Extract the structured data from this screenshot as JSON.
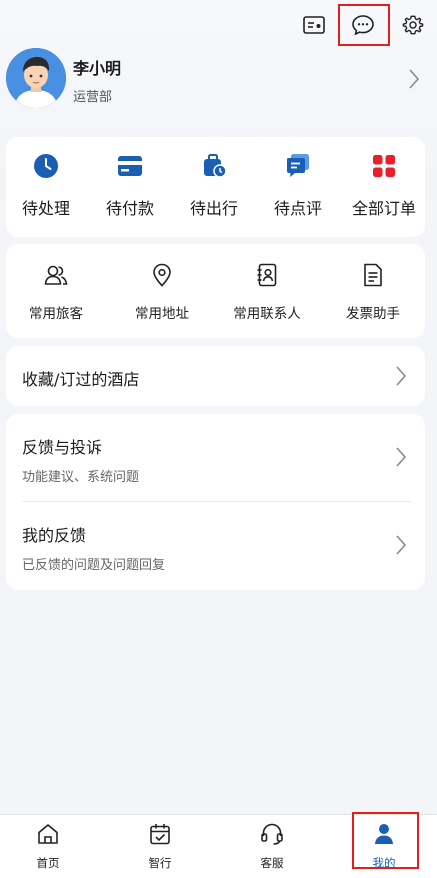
{
  "profile": {
    "name": "李小明",
    "department": "运营部"
  },
  "orders": [
    {
      "label": "待处理",
      "icon": "clock-icon"
    },
    {
      "label": "待付款",
      "icon": "card-icon"
    },
    {
      "label": "待出行",
      "icon": "luggage-icon"
    },
    {
      "label": "待点评",
      "icon": "comment-icon"
    },
    {
      "label": "全部订单",
      "icon": "grid-icon"
    }
  ],
  "services": [
    {
      "label": "常用旅客",
      "icon": "users-icon"
    },
    {
      "label": "常用地址",
      "icon": "location-pin-icon"
    },
    {
      "label": "常用联系人",
      "icon": "contacts-book-icon"
    },
    {
      "label": "发票助手",
      "icon": "invoice-icon"
    }
  ],
  "hotels": {
    "label": "收藏/订过的酒店"
  },
  "feedback": {
    "complaint": {
      "title": "反馈与投诉",
      "subtitle": "功能建议、系统问题"
    },
    "mine": {
      "title": "我的反馈",
      "subtitle": "已反馈的问题及问题回复"
    }
  },
  "tabs": [
    {
      "label": "首页",
      "icon": "home-icon"
    },
    {
      "label": "智行",
      "icon": "calendar-check-icon"
    },
    {
      "label": "客服",
      "icon": "headset-icon"
    },
    {
      "label": "我的",
      "icon": "person-icon",
      "active": true
    }
  ],
  "colors": {
    "accent_blue": "#1a5fb4",
    "accent_red": "#e8202a",
    "highlight": "#e0201c"
  }
}
